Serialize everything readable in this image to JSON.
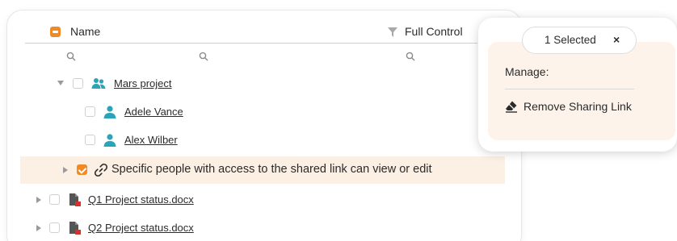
{
  "grid": {
    "columns": {
      "name": "Name",
      "full_control": "Full Control"
    },
    "rows": [
      {
        "label": "Mars project",
        "type": "group"
      },
      {
        "label": "Adele Vance",
        "type": "user"
      },
      {
        "label": "Alex Wilber",
        "type": "user"
      },
      {
        "label": "Specific people with access to the shared link can view or edit",
        "type": "sharing-link"
      },
      {
        "label": "Q1 Project status.docx",
        "type": "document"
      },
      {
        "label": "Q2 Project status.docx",
        "type": "document"
      }
    ]
  },
  "panel": {
    "selected_label": "1 Selected",
    "close_glyph": "×",
    "manage_label": "Manage:",
    "actions": [
      {
        "label": "Remove Sharing Link",
        "icon": "eraser-icon"
      }
    ]
  },
  "colors": {
    "accent": "#f08a24",
    "selected_row": "#fcefe3",
    "user_icon": "#2ba3b8",
    "doc_icon": "#555555",
    "doc_badge": "#d9302a"
  }
}
